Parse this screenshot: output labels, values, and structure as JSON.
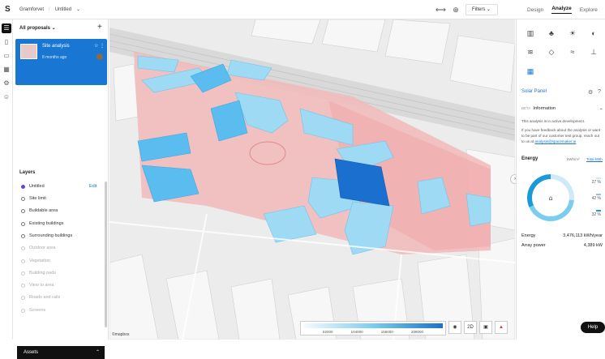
{
  "app": {
    "brand": "S",
    "workspace": "Gramforvet",
    "project": "Untitled"
  },
  "topbar": {
    "filters_label": "Filters"
  },
  "tabs": [
    {
      "label": "Design"
    },
    {
      "label": "Analyze"
    },
    {
      "label": "Explore"
    }
  ],
  "left_panel": {
    "header": "All proposals",
    "proposal": {
      "title": "Site analysis",
      "subtitle": "8 months ago"
    },
    "layers_title": "Layers",
    "layers": [
      {
        "label": "Untitled",
        "edit": "Edit"
      },
      {
        "label": "Site limit"
      },
      {
        "label": "Buildable area"
      },
      {
        "label": "Existing buildings"
      },
      {
        "label": "Surrounding buildings"
      },
      {
        "label": "Outdoor area"
      },
      {
        "label": "Vegetation"
      },
      {
        "label": "Building pads"
      },
      {
        "label": "View to area"
      },
      {
        "label": "Roads and rails"
      },
      {
        "label": "Screens"
      }
    ],
    "assets_label": "Assets"
  },
  "map": {
    "legend_ticks": [
      "52000",
      "104000",
      "156000",
      "208000"
    ],
    "view_mode": "2D",
    "attribution": "©mapbox"
  },
  "right_panel": {
    "tool_title": "Solar Panel",
    "info_beta": "BETA",
    "info_title": "Information",
    "para1": "This analysis is in active development.",
    "para2": "If you have feedback about the analysis or want to be part of our customer test group, reach out to us at",
    "para2_link": "analysis@spacemaker.ai",
    "energy_title": "Energy",
    "energy_tabs": [
      "kWh/m²",
      "Total kWh"
    ],
    "percentages": [
      {
        "value": "27 %",
        "color": "#cfeaf7"
      },
      {
        "value": "42 %",
        "color": "#7bcdf0"
      },
      {
        "value": "32 %",
        "color": "#1a9ad9"
      }
    ],
    "donut_shares": [
      0.27,
      0.42,
      0.32
    ],
    "energy_label": "Energy",
    "energy_value": "3,476,113 kWh/year",
    "array_label": "Array power",
    "array_value": "4,389 kW"
  },
  "help_label": "Help",
  "colors": {
    "accent": "#1976d2",
    "site": "#f2b8b8",
    "low": "#cfeaf7",
    "mid": "#7bcdf0",
    "high": "#1a73c9"
  }
}
